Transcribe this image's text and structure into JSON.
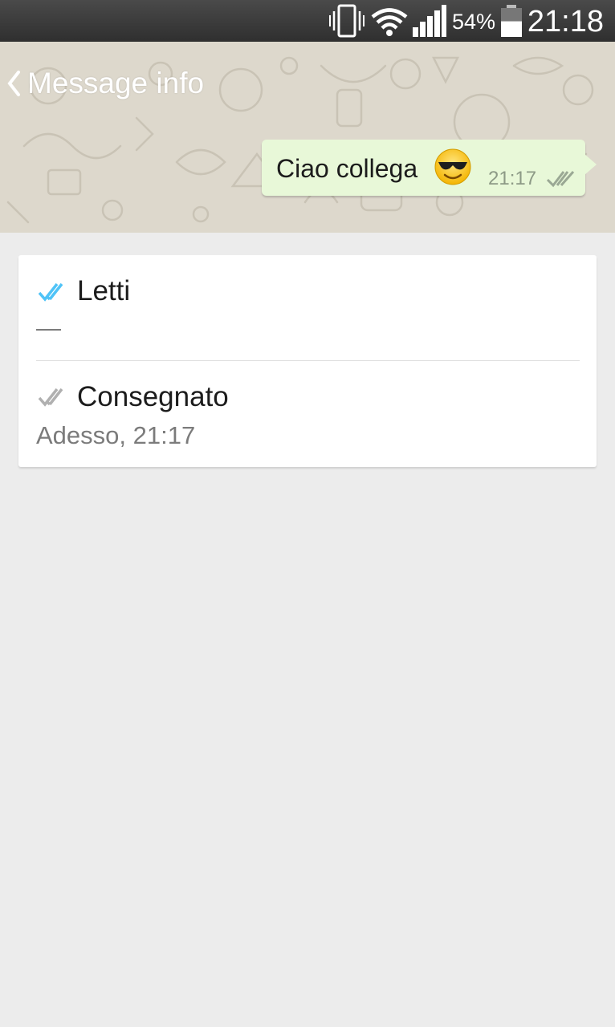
{
  "status_bar": {
    "battery_percent": "54%",
    "time": "21:18",
    "icons": [
      "vibrate-icon",
      "wifi-icon",
      "signal-icon",
      "battery-icon"
    ],
    "battery_level": 0.54
  },
  "header": {
    "title": "Message info",
    "back_icon": "chevron-left-icon"
  },
  "message": {
    "text": "Ciao collega",
    "emoji": "smiling-face-with-sunglasses",
    "time": "21:17",
    "status_icon": "double-check-icon",
    "bubble_color": "#e8f8d8"
  },
  "info": {
    "read": {
      "label": "Letti",
      "value": "—",
      "icon": "double-check-blue-icon",
      "icon_color": "#4fc3f7"
    },
    "delivered": {
      "label": "Consegnato",
      "value": "Adesso, 21:17",
      "icon": "double-check-gray-icon",
      "icon_color": "#b0b0b0"
    }
  }
}
